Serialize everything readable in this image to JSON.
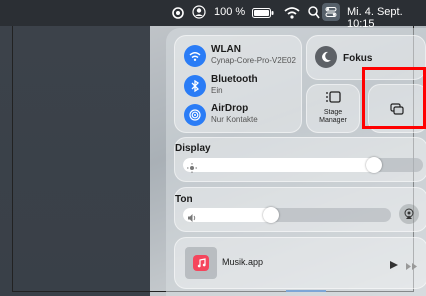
{
  "menubar": {
    "battery_percent": "100 %",
    "datetime": "Mi. 4. Sept.  10:15"
  },
  "wifi": {
    "label": "WLAN",
    "network": "Cynap-Core-Pro-V2E02"
  },
  "bluetooth": {
    "label": "Bluetooth",
    "status": "Ein"
  },
  "airdrop": {
    "label": "AirDrop",
    "status": "Nur Kontakte"
  },
  "focus": {
    "label": "Fokus"
  },
  "stage_manager": {
    "label_line1": "Stage",
    "label_line2": "Manager"
  },
  "display": {
    "label": "Display",
    "brightness": 0.82
  },
  "sound": {
    "label": "Ton",
    "volume": 0.45
  },
  "music": {
    "label": "Musik.app"
  },
  "colors": {
    "accent": "#2a7cf6",
    "highlight": "#ff0000",
    "music_icon": "#f5455c"
  }
}
